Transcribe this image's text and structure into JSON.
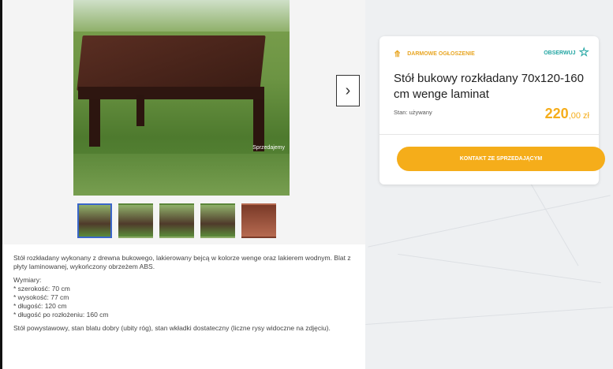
{
  "gallery": {
    "watermark": "Sprzedajemy",
    "next_icon": "chevron-right-icon",
    "thumbnails": [
      "thumb-1",
      "thumb-2",
      "thumb-3",
      "thumb-4",
      "thumb-5"
    ]
  },
  "description": {
    "intro": "Stół rozkładany wykonany z drewna bukowego, lakierowany bejcą w kolorze wenge oraz lakierem wodnym. Blat z płyty laminowanej, wykończony obrzeżem ABS.",
    "dims_title": "Wymiary:",
    "dims": [
      "* szerokość: 70 cm",
      "* wysokość: 77 cm",
      "* długość: 120 cm",
      "* długość po rozłożeniu: 160 cm"
    ],
    "condition_note": "Stół powystawowy, stan blatu dobry (ubity róg), stan wkładki dostateczny (liczne rysy widoczne na zdjęciu)."
  },
  "card": {
    "badge": "DARMOWE OGŁOSZENIE",
    "watch": "OBSERWUJ",
    "title": "Stół bukowy rozkładany 70x120-160 cm wenge laminat",
    "condition": "Stan: używany",
    "price_main": "220",
    "price_rest": ",00 zł",
    "contact": "KONTAKT ZE SPRZEDAJĄCYM",
    "colors": {
      "accent": "#f5ad1a",
      "teal": "#23a6a3"
    }
  }
}
